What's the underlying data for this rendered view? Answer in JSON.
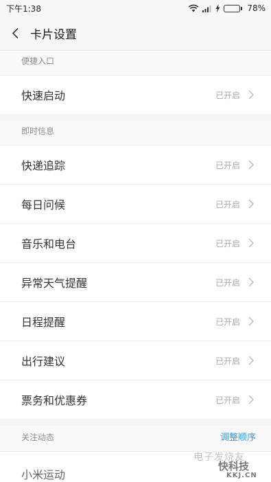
{
  "status_bar": {
    "time": "下午1:38",
    "battery_text": "78%",
    "battery_level": 0.78
  },
  "header": {
    "title": "卡片设置"
  },
  "sections": [
    {
      "title": "便捷入口",
      "items": [
        {
          "label": "快速启动",
          "status": "已开启"
        }
      ]
    },
    {
      "title": "即时信息",
      "items": [
        {
          "label": "快递追踪",
          "status": "已开启"
        },
        {
          "label": "每日问候",
          "status": "已开启"
        },
        {
          "label": "音乐和电台",
          "status": "已开启"
        },
        {
          "label": "异常天气提醒",
          "status": "已开启"
        },
        {
          "label": "日程提醒",
          "status": "已开启"
        },
        {
          "label": "出行建议",
          "status": "已开启"
        },
        {
          "label": "票务和优惠券",
          "status": "已开启"
        }
      ]
    },
    {
      "title": "关注动态",
      "action": "调整顺序",
      "items": [
        {
          "label": "小米运动"
        }
      ]
    }
  ],
  "watermark": {
    "line1": "电子发烧友",
    "line2": "快科技",
    "line3": "KKJ.CN"
  },
  "colors": {
    "accent": "#2d9ce8",
    "battery": "#33b94a",
    "divider": "#ececec"
  }
}
